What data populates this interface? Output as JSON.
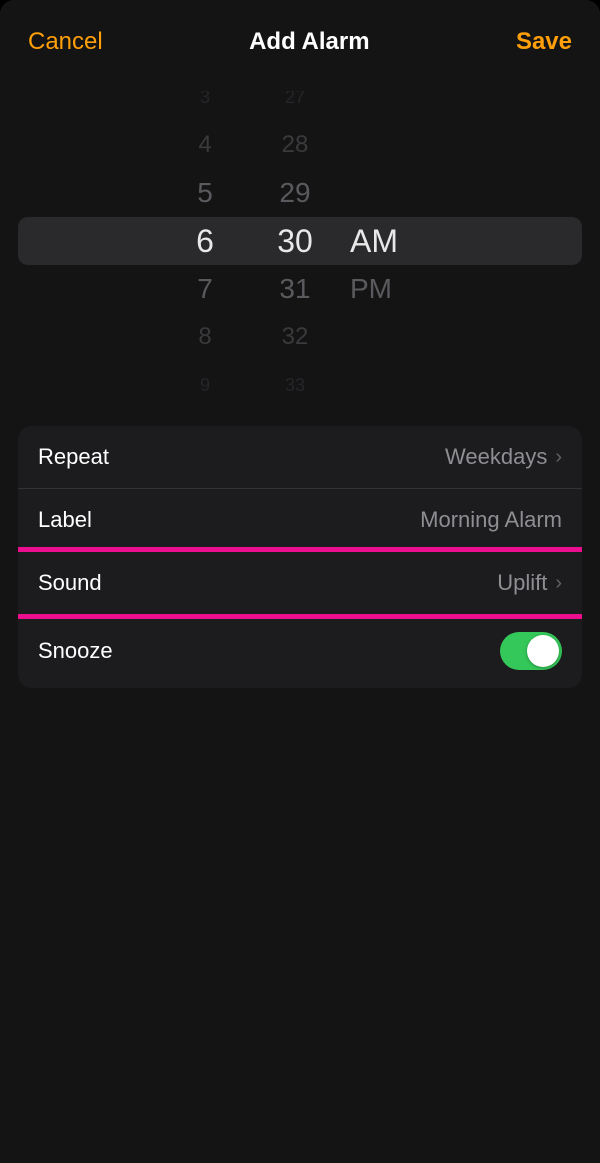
{
  "header": {
    "cancel": "Cancel",
    "title": "Add Alarm",
    "save": "Save"
  },
  "picker": {
    "hours": [
      "3",
      "4",
      "5",
      "6",
      "7",
      "8",
      "9"
    ],
    "minutes": [
      "27",
      "28",
      "29",
      "30",
      "31",
      "32",
      "33"
    ],
    "ampm": {
      "am": "AM",
      "pm": "PM"
    },
    "selected": {
      "hour": "6",
      "minute": "30",
      "period": "AM"
    }
  },
  "rows": {
    "repeat": {
      "label": "Repeat",
      "value": "Weekdays"
    },
    "label_row": {
      "label": "Label",
      "value": "Morning Alarm"
    },
    "sound": {
      "label": "Sound",
      "value": "Uplift"
    },
    "snooze": {
      "label": "Snooze",
      "on": true
    }
  }
}
